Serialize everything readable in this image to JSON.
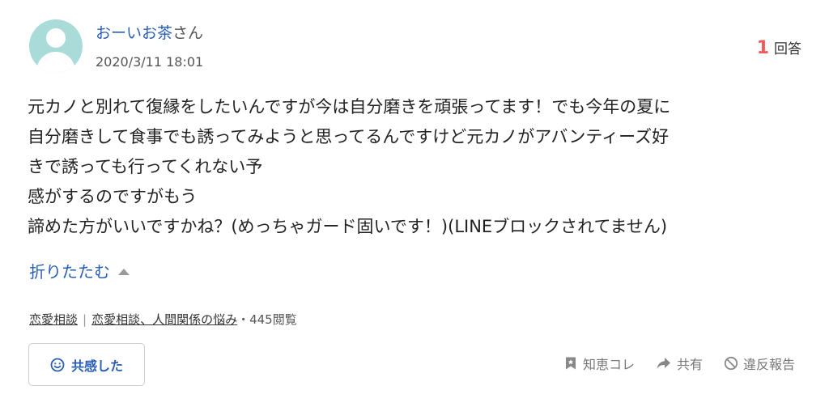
{
  "question": {
    "user": {
      "name": "おーいお茶",
      "honorific": "さん",
      "avatar_color": "#a9dcd9"
    },
    "timestamp": "2020/3/11 18:01",
    "answers": {
      "count": "1",
      "label": "回答",
      "count_color": "#ef5b5b"
    },
    "body_lines": [
      "元カノと別れて復縁をしたいんですが今は自分磨きを頑張ってます！でも今年の夏に",
      "自分磨きして食事でも誘ってみようと思ってるんですけど元カノがアバンティーズ好",
      "きで誘っても行ってくれない予",
      "感がするのですがもう",
      "諦めた方がいいですかね？(めっちゃガード固いです！)(LINEブロックされてません)"
    ],
    "collapse_label": "折りたたむ",
    "categories": [
      "恋愛相談",
      "恋愛相談、人間関係の悩み"
    ],
    "views": "・445閲覧",
    "empathy_label": "共感した",
    "actions": {
      "bookmark": "知恵コレ",
      "share": "共有",
      "report": "違反報告"
    },
    "link_color": "#2a5fb7"
  }
}
